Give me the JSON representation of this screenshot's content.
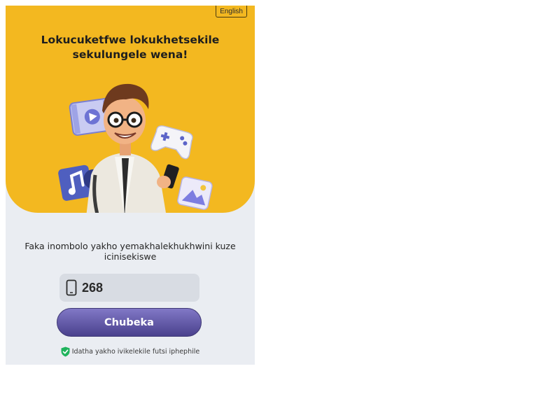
{
  "language_button": "English",
  "hero": {
    "title": "Lokucuketfwe lokukhetsekile sekulungele wena!"
  },
  "form": {
    "prompt": "Faka inombolo yakho yemakhalekhukhwini kuze icinisekiswe",
    "phone_value": "268",
    "continue_label": "Chubeka",
    "secure_note": "Idatha yakho ivikelekile futsi iphephile"
  },
  "icons": {
    "phone": "mobile-phone-icon",
    "shield": "shield-check-icon",
    "illustration": [
      "video-film-icon",
      "game-controller-icon",
      "music-note-icon",
      "image-gallery-icon"
    ]
  },
  "colors": {
    "hero_bg": "#f3b820",
    "page_bg": "#eaedf2",
    "button_top": "#8178c6",
    "button_bottom": "#4a418d",
    "shield": "#1fb35c"
  }
}
